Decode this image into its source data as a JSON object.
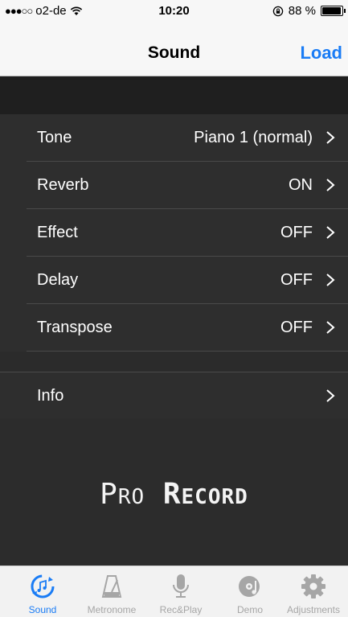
{
  "status": {
    "carrier": "o2-de",
    "time": "10:20",
    "battery": "88 %",
    "battery_level": 0.88
  },
  "nav": {
    "title": "Sound",
    "load_label": "Load"
  },
  "rows": [
    {
      "label": "Tone",
      "value": "Piano 1 (normal)"
    },
    {
      "label": "Reverb",
      "value": "ON"
    },
    {
      "label": "Effect",
      "value": "OFF"
    },
    {
      "label": "Delay",
      "value": "OFF"
    },
    {
      "label": "Transpose",
      "value": "OFF"
    }
  ],
  "info": {
    "label": "Info"
  },
  "brand": {
    "pro": "Pro",
    "record": "Record"
  },
  "tabs": [
    {
      "label": "Sound",
      "icon": "sound-sync-icon",
      "active": true
    },
    {
      "label": "Metronome",
      "icon": "metronome-icon"
    },
    {
      "label": "Rec&Play",
      "icon": "microphone-icon"
    },
    {
      "label": "Demo",
      "icon": "demo-disc-icon"
    },
    {
      "label": "Adjustments",
      "icon": "gear-icon"
    }
  ],
  "colors": {
    "accent": "#1a7cf5",
    "background": "#2e2e2e",
    "tab_inactive": "#a6a6a6"
  }
}
